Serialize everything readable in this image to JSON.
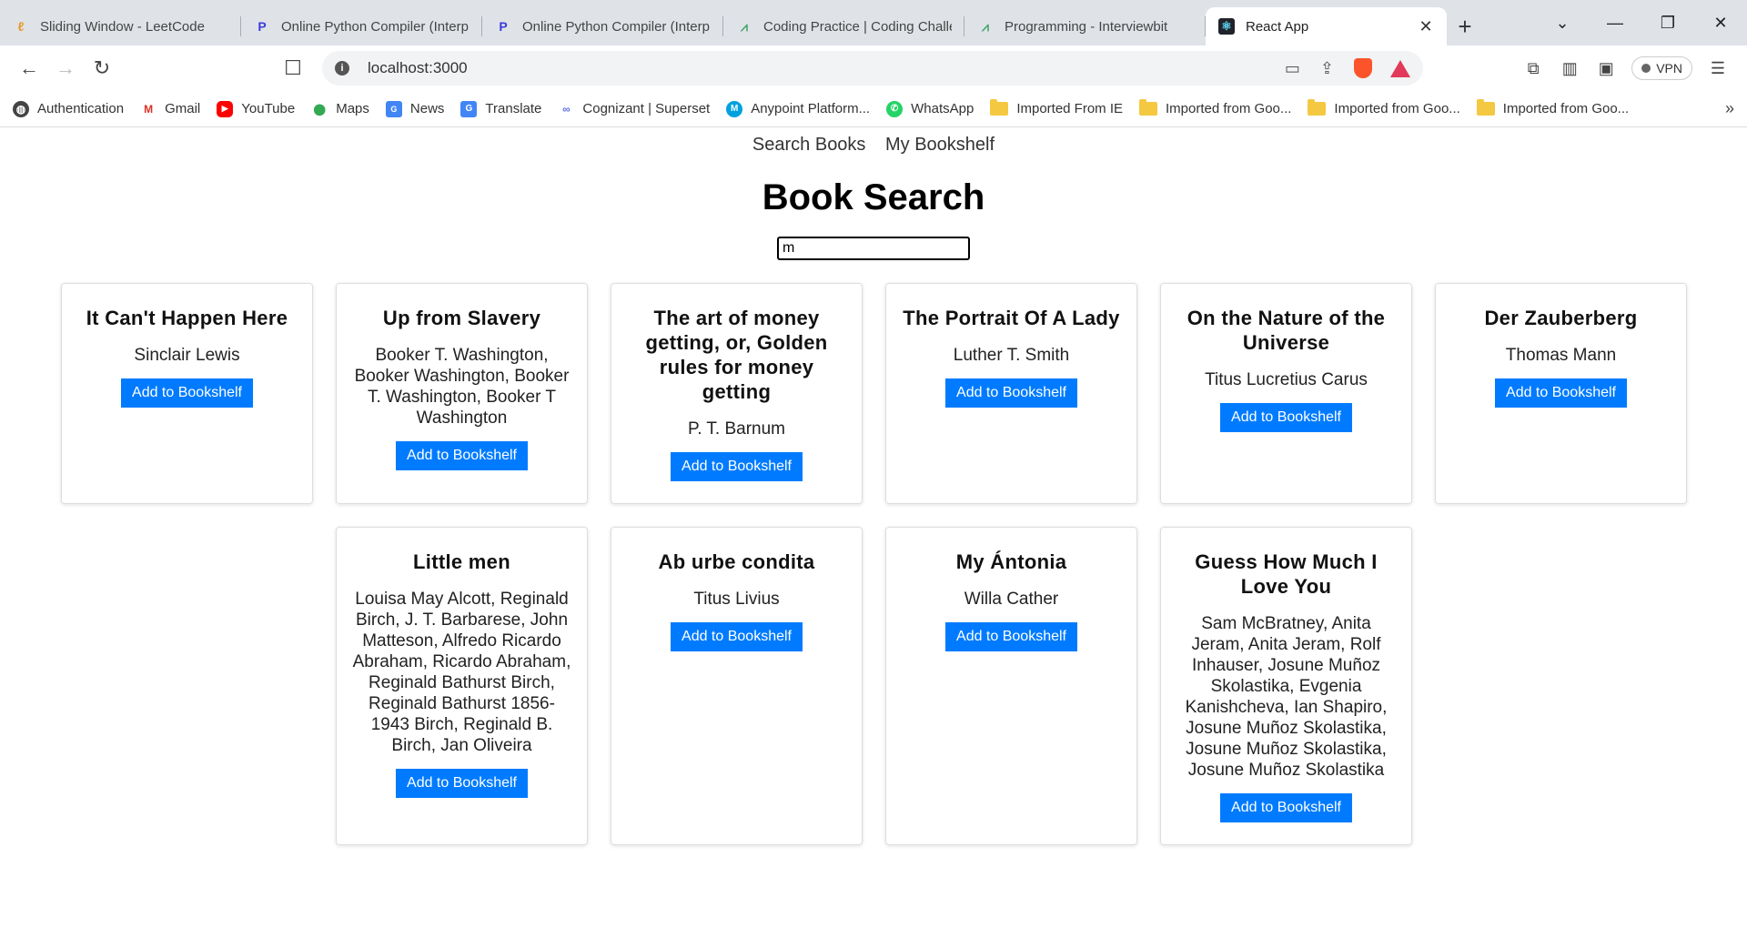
{
  "tabs": [
    {
      "title": "Sliding Window - LeetCode",
      "icon": "leetcode-icon"
    },
    {
      "title": "Online Python Compiler (Interp",
      "icon": "programiz-icon"
    },
    {
      "title": "Online Python Compiler (Interp",
      "icon": "programiz-icon"
    },
    {
      "title": "Coding Practice | Coding Challe",
      "icon": "gfg-icon"
    },
    {
      "title": "Programming - Interviewbit",
      "icon": "interviewbit-icon"
    },
    {
      "title": "React App",
      "icon": "react-icon",
      "active": true
    }
  ],
  "address_bar": {
    "url": "localhost:3000"
  },
  "vpn_label": "VPN",
  "bookmarks": [
    {
      "label": "Authentication",
      "icon": "globe-icon"
    },
    {
      "label": "Gmail",
      "icon": "gmail-icon"
    },
    {
      "label": "YouTube",
      "icon": "youtube-icon"
    },
    {
      "label": "Maps",
      "icon": "maps-icon"
    },
    {
      "label": "News",
      "icon": "news-icon"
    },
    {
      "label": "Translate",
      "icon": "translate-icon"
    },
    {
      "label": "Cognizant | Superset",
      "icon": "superset-icon"
    },
    {
      "label": "Anypoint Platform...",
      "icon": "mulesoft-icon"
    },
    {
      "label": "WhatsApp",
      "icon": "whatsapp-icon"
    },
    {
      "label": "Imported From IE",
      "icon": "folder-icon"
    },
    {
      "label": "Imported from Goo...",
      "icon": "folder-icon"
    },
    {
      "label": "Imported from Goo...",
      "icon": "folder-icon"
    },
    {
      "label": "Imported from Goo...",
      "icon": "folder-icon"
    }
  ],
  "app": {
    "nav": {
      "search": "Search Books",
      "bookshelf": "My Bookshelf"
    },
    "heading": "Book Search",
    "search_value": "m",
    "add_label": "Add to Bookshelf",
    "books": [
      {
        "title": "It Can't Happen Here",
        "author": "Sinclair Lewis"
      },
      {
        "title": "Up from Slavery",
        "author": "Booker T. Washington, Booker Washington, Booker T. Washington, Booker T Washington"
      },
      {
        "title": "The art of money getting, or, Golden rules for money getting",
        "author": "P. T. Barnum"
      },
      {
        "title": "The Portrait Of A Lady",
        "author": "Luther T. Smith"
      },
      {
        "title": "On the Nature of the Universe",
        "author": "Titus Lucretius Carus"
      },
      {
        "title": "Der Zauberberg",
        "author": "Thomas Mann"
      },
      {
        "title": "Little men",
        "author": "Louisa May Alcott, Reginald Birch, J. T. Barbarese, John Matteson, Alfredo Ricardo Abraham, Ricardo Abraham, Reginald Bathurst Birch, Reginald Bathurst 1856-1943 Birch, Reginald B. Birch, Jan Oliveira"
      },
      {
        "title": "Ab urbe condita",
        "author": "Titus Livius"
      },
      {
        "title": "My Ántonia",
        "author": "Willa Cather"
      },
      {
        "title": "Guess How Much I Love You",
        "author": "Sam McBratney, Anita Jeram, Anita Jeram, Rolf Inhauser, Josune Muñoz Skolastika, Evgenia Kanishcheva, Ian Shapiro, Josune Muñoz Skolastika, Josune Muñoz Skolastika, Josune Muñoz Skolastika"
      }
    ]
  }
}
